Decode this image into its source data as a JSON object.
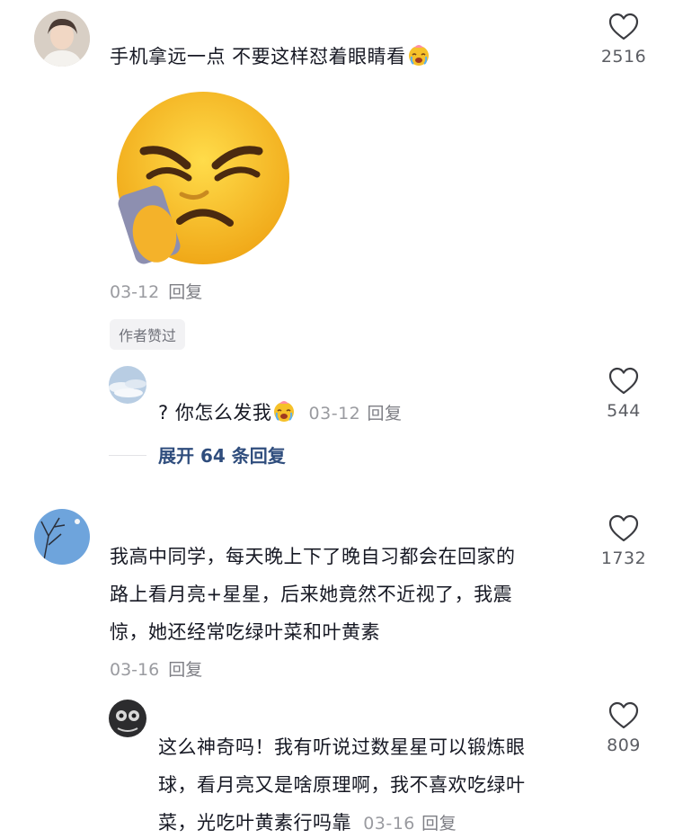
{
  "comments": [
    {
      "text": "手机拿远一点 不要这样怼着眼睛看",
      "inline_emoji": "crying-face-emoji",
      "sticker": "squinting-phone-emoji-sticker",
      "date": "03-12",
      "reply_label": "回复",
      "badge": "作者赞过",
      "likes": "2516",
      "avatar": "user-avatar",
      "reply": {
        "prefix": "?",
        "text": "你怎么发我",
        "inline_emoji": "crying-face-emoji",
        "date": "03-12",
        "reply_label": "回复",
        "likes": "544"
      },
      "expand_label": "展开 64 条回复"
    },
    {
      "lines": [
        "我高中同学，每天晚上下了晚自习都会在回家的",
        "路上看月亮+星星，后来她竟然不近视了，我震",
        "惊，她还经常吃绿叶菜和叶黄素"
      ],
      "date": "03-16",
      "reply_label": "回复",
      "likes": "1732",
      "reply": {
        "lines": [
          "这么神奇吗！我有听说过数星星可以锻炼眼",
          "球，看月亮又是啥原理啊，我不喜欢吃绿叶",
          "菜，光吃叶黄素行吗靠"
        ],
        "date": "03-16",
        "reply_label": "回复",
        "likes": "809"
      }
    }
  ],
  "colors": {
    "text": "#161823",
    "meta": "#9a9ba0",
    "expand": "#2f4d7d",
    "emoji_yellow": "#f6c12a"
  }
}
